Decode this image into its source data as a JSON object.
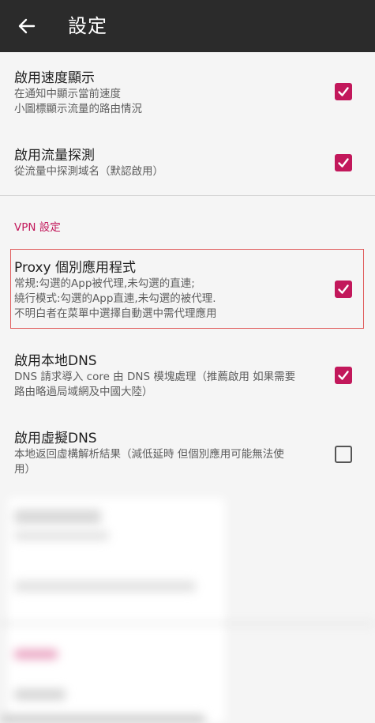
{
  "appbar": {
    "title": "設定",
    "back_icon": "arrow-left-icon"
  },
  "settings": [
    {
      "title": "啟用速度顯示",
      "summary": [
        "在通知中顯示當前速度",
        "小圖標顯示流量的路由情況"
      ],
      "checked": true
    },
    {
      "title": "啟用流量探測",
      "summary": [
        "從流量中探測域名（默認啟用）"
      ],
      "checked": true
    }
  ],
  "vpn_section": {
    "header": "VPN 設定",
    "items": [
      {
        "title": "Proxy 個別應用程式",
        "summary": [
          "常規:勾選的App被代理,未勾選的直連;",
          "繞行模式:勾選的App直連,未勾選的被代理.",
          "不明白者在菜單中選擇自動選中需代理應用"
        ],
        "checked": true
      },
      {
        "title": "啟用本地DNS",
        "summary": [
          "DNS 請求導入 core 由 DNS 模塊處理（推薦啟用 如果需要",
          "路由略過局域網及中國大陸）"
        ],
        "checked": true
      },
      {
        "title": "啟用虛擬DNS",
        "summary": [
          "本地返回虛構解析結果（減低延時 但個別應用可能無法使",
          "用）"
        ],
        "checked": false
      }
    ]
  },
  "colors": {
    "accent": "#c2185b",
    "appbar": "#2b2b2b",
    "background": "#f5f5f5"
  }
}
